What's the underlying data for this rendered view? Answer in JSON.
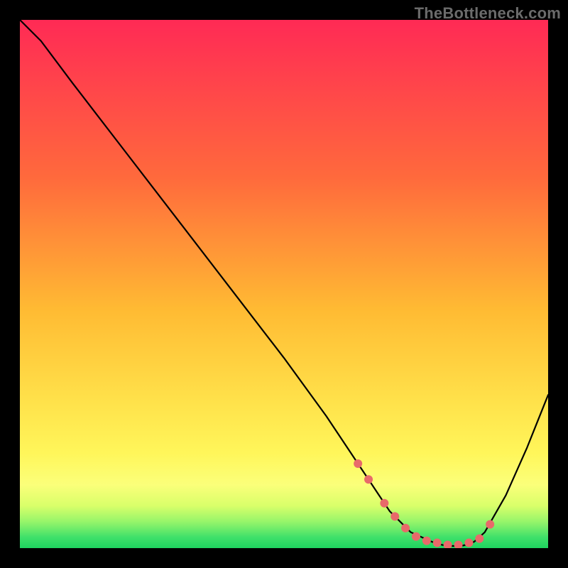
{
  "watermark": "TheBottleneck.com",
  "chart_data": {
    "type": "line",
    "title": "",
    "xlabel": "",
    "ylabel": "",
    "xlim": [
      0,
      100
    ],
    "ylim": [
      0,
      100
    ],
    "grid": false,
    "gradient_stops": [
      {
        "offset": 0,
        "color": "#ff2a55"
      },
      {
        "offset": 30,
        "color": "#ff6a3c"
      },
      {
        "offset": 55,
        "color": "#ffbb33"
      },
      {
        "offset": 72,
        "color": "#ffe14a"
      },
      {
        "offset": 82,
        "color": "#fff65a"
      },
      {
        "offset": 88,
        "color": "#fbff7a"
      },
      {
        "offset": 92,
        "color": "#d9ff6a"
      },
      {
        "offset": 95,
        "color": "#96f56a"
      },
      {
        "offset": 98,
        "color": "#3ee06a"
      },
      {
        "offset": 100,
        "color": "#1fd45f"
      }
    ],
    "series": [
      {
        "name": "bottleneck-curve",
        "x": [
          0,
          4,
          10,
          20,
          30,
          40,
          50,
          58,
          62,
          66,
          68,
          70,
          74,
          78,
          80,
          82,
          84,
          86,
          88,
          92,
          96,
          100
        ],
        "y": [
          100,
          96,
          88,
          75,
          62,
          49,
          36,
          25,
          19,
          13,
          10,
          7,
          3,
          1.2,
          0.6,
          0.4,
          0.5,
          1.2,
          3,
          10,
          19,
          29
        ]
      }
    ],
    "highlight_points": {
      "name": "optimal-zone-markers",
      "x": [
        64,
        66,
        69,
        71,
        73,
        75,
        77,
        79,
        81,
        83,
        85,
        87,
        89
      ],
      "y": [
        16,
        13,
        8.5,
        6,
        3.8,
        2.2,
        1.4,
        1.0,
        0.6,
        0.6,
        1.0,
        1.8,
        4.5
      ],
      "color": "#e86a6a",
      "radius": 6
    }
  }
}
